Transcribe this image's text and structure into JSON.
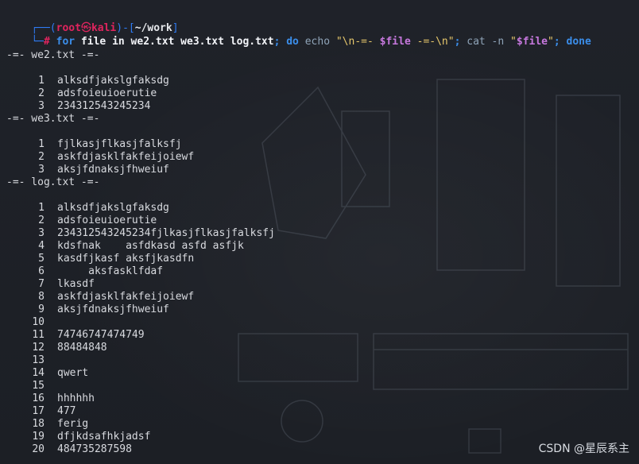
{
  "prompt": {
    "top_left": "┌──(",
    "user": "root",
    "at": "㉿",
    "host": "kali",
    "mid": ")-[",
    "path": "~/work",
    "end": "]",
    "second": "└─",
    "hash": "#"
  },
  "command": {
    "for": "for",
    "rest1": " file ",
    "in": "in",
    "files": " we2.txt we3.txt log.txt",
    "semi1": ";",
    "do": " do",
    "echo": " echo",
    "str1": " \"\\n-=- ",
    "var1": "$file",
    "str2": " -=-\\n\"",
    "semi2": ";",
    "cat": " cat",
    "opt": " -n",
    "q1": " \"",
    "var2": "$file",
    "q2": "\"",
    "semi3": ";",
    "done": " done"
  },
  "sections": [
    {
      "header": "-=- we2.txt -=-",
      "lines": [
        [
          "1",
          "alksdfjakslgfaksdg"
        ],
        [
          "2",
          "adsfoieuioerutie"
        ],
        [
          "3",
          "234312543245234"
        ]
      ]
    },
    {
      "header": "-=- we3.txt -=-",
      "lines": [
        [
          "1",
          "fjlkasjflkasjfalksfj"
        ],
        [
          "2",
          "askfdjasklfakfeijoiewf"
        ],
        [
          "3",
          "aksjfdnaksjfhweiuf"
        ]
      ]
    },
    {
      "header": "-=- log.txt -=-",
      "lines": [
        [
          "1",
          "alksdfjakslgfaksdg"
        ],
        [
          "2",
          "adsfoieuioerutie"
        ],
        [
          "3",
          "234312543245234fjlkasjflkasjfalksfj"
        ],
        [
          "4",
          "kdsfnak    asfdkasd asfd asfjk"
        ],
        [
          "5",
          "kasdfjkasf aksfjkasdfn"
        ],
        [
          "6",
          "     aksfasklfdaf"
        ],
        [
          "7",
          "lkasdf"
        ],
        [
          "8",
          "askfdjasklfakfeijoiewf"
        ],
        [
          "9",
          "aksjfdnaksjfhweiuf"
        ],
        [
          "10",
          ""
        ],
        [
          "11",
          "74746747474749"
        ],
        [
          "12",
          "88484848"
        ],
        [
          "13",
          ""
        ],
        [
          "14",
          "qwert"
        ],
        [
          "15",
          ""
        ],
        [
          "16",
          "hhhhhh"
        ],
        [
          "17",
          "477"
        ],
        [
          "18",
          "ferig"
        ],
        [
          "19",
          "dfjkdsafhkjadsf"
        ],
        [
          "20",
          "484735287598"
        ]
      ]
    }
  ],
  "watermark": "CSDN @星辰系主",
  "colors": {
    "blue": "#2f7cf5",
    "red": "#e0245e",
    "background": "#1e2128"
  }
}
